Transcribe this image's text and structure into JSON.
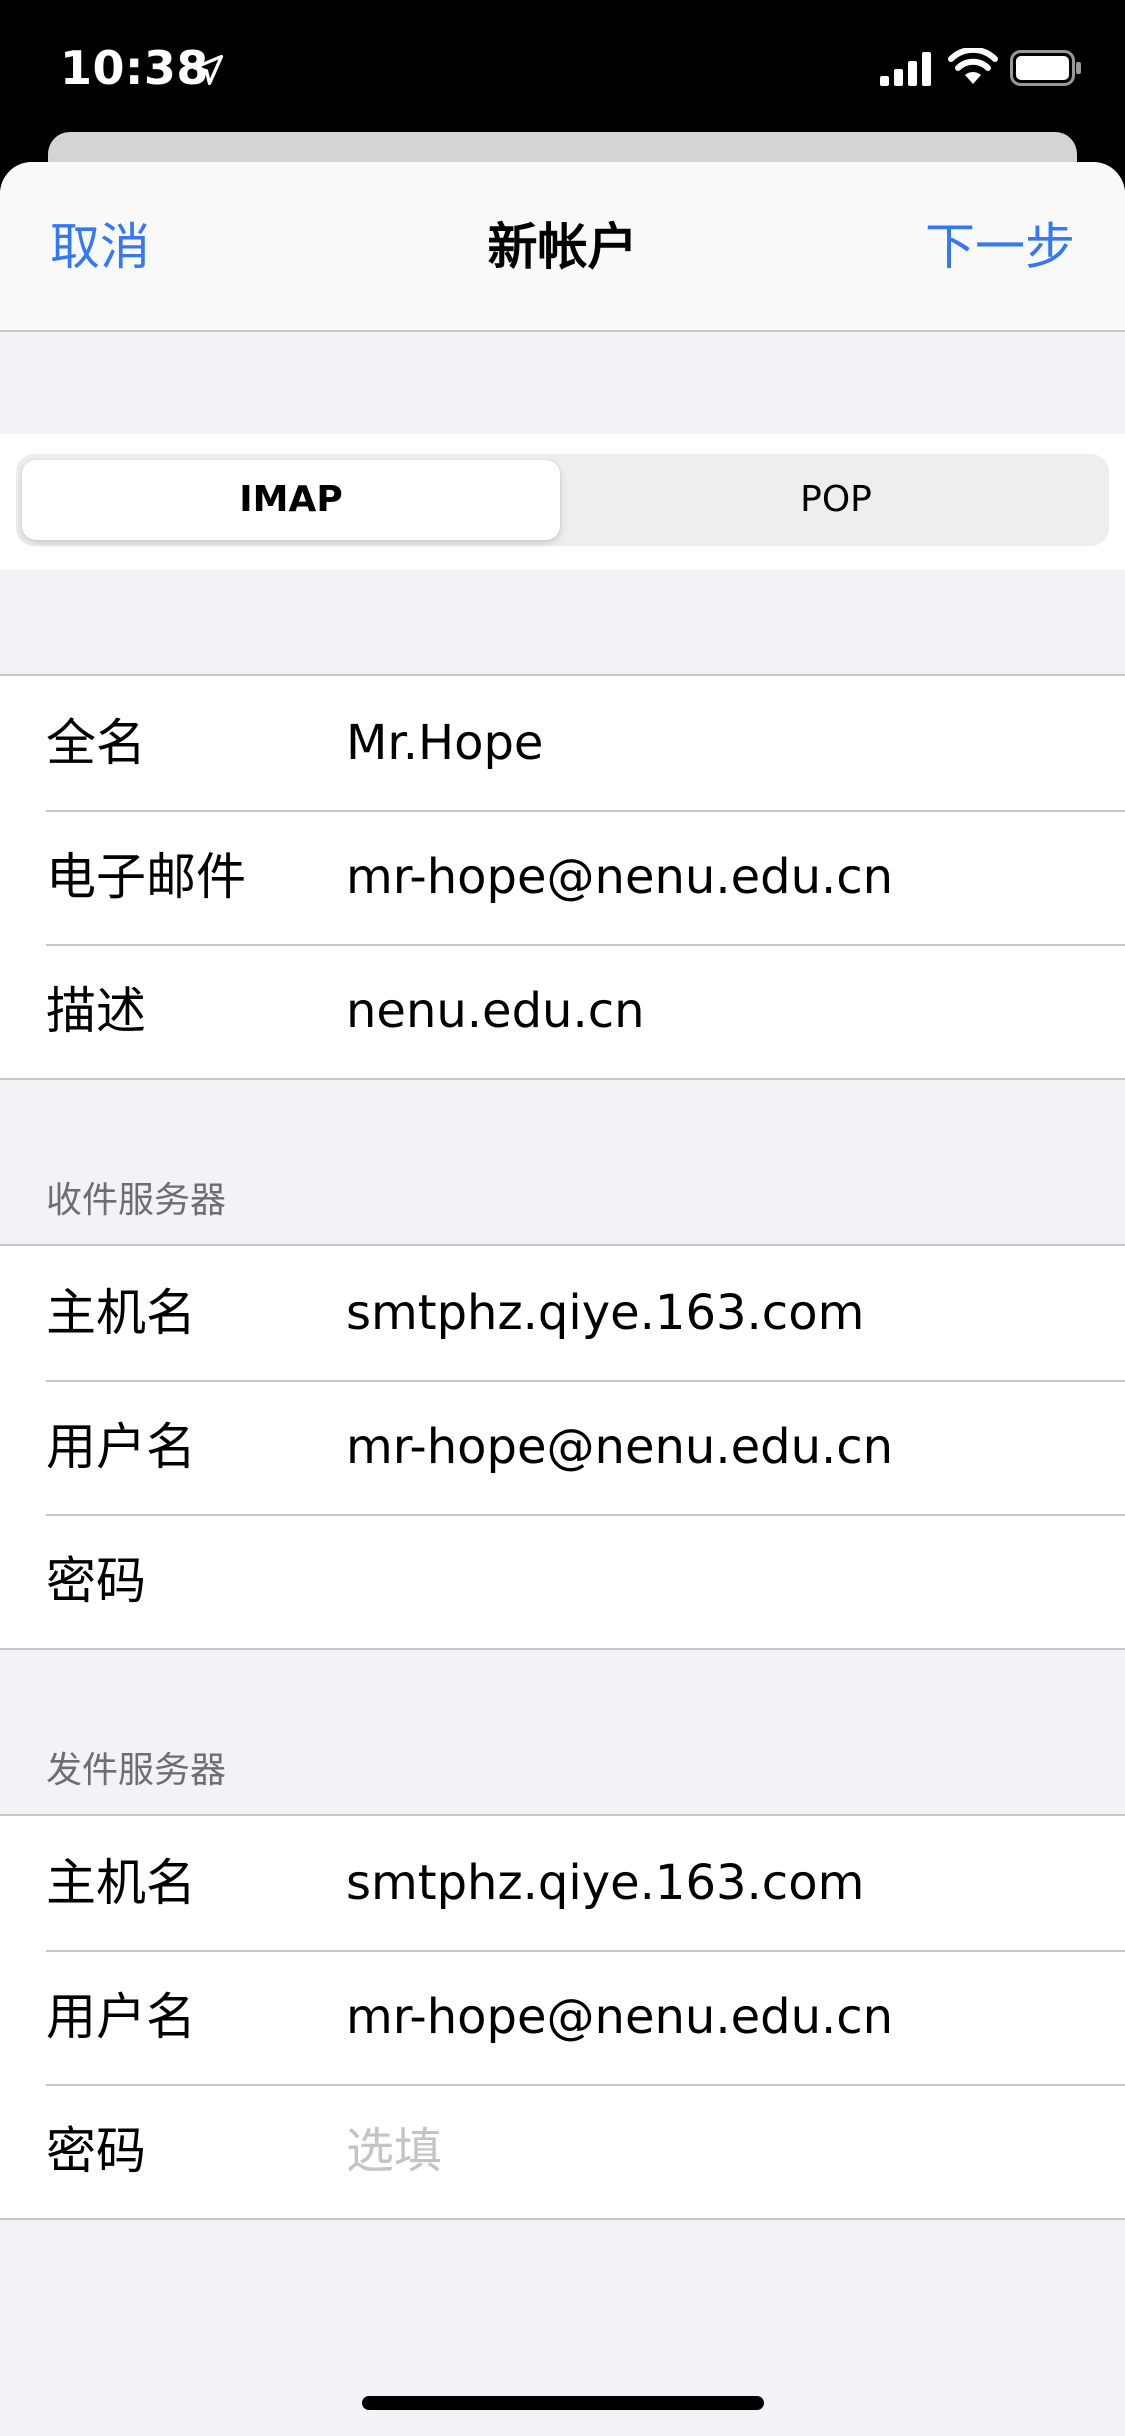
{
  "status_bar": {
    "time": "10:38",
    "icons": [
      "location-arrow-icon",
      "cellular-signal-icon",
      "wifi-icon",
      "battery-icon"
    ]
  },
  "nav": {
    "cancel_label": "取消",
    "title": "新帐户",
    "next_label": "下一步"
  },
  "segment": {
    "options": [
      "IMAP",
      "POP"
    ],
    "selected": "IMAP"
  },
  "account": {
    "fields": [
      {
        "label": "全名",
        "value": "Mr.Hope"
      },
      {
        "label": "电子邮件",
        "value": "mr-hope@nenu.edu.cn"
      },
      {
        "label": "描述",
        "value": "nenu.edu.cn"
      }
    ]
  },
  "incoming": {
    "header": "收件服务器",
    "fields": [
      {
        "label": "主机名",
        "value": "smtphz.qiye.163.com"
      },
      {
        "label": "用户名",
        "value": "mr-hope@nenu.edu.cn"
      },
      {
        "label": "密码",
        "value": ""
      }
    ]
  },
  "outgoing": {
    "header": "发件服务器",
    "fields": [
      {
        "label": "主机名",
        "value": "smtphz.qiye.163.com"
      },
      {
        "label": "用户名",
        "value": "mr-hope@nenu.edu.cn"
      },
      {
        "label": "密码",
        "value": "",
        "placeholder": "选填"
      }
    ]
  },
  "colors": {
    "accent": "#3478f6",
    "grouped_background": "#f2f2f7",
    "separator": "#c8c7cc",
    "section_header_text": "#6d6d72",
    "placeholder_text": "#c4c4c6"
  }
}
